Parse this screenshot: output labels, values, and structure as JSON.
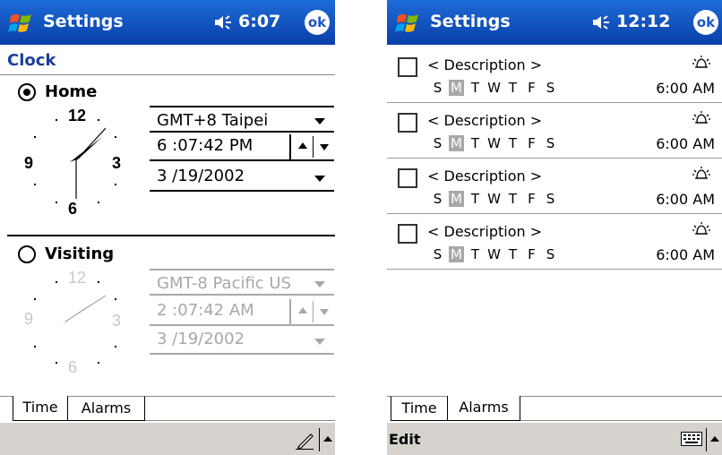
{
  "left": {
    "titlebar": {
      "title": "Settings",
      "time": "6:07",
      "ok": "ok",
      "volume_icon": "speaker-icon"
    },
    "header": "Clock",
    "home": {
      "label": "Home",
      "selected": true,
      "timezone": "GMT+8 Taipei",
      "time": "6 :07:42 PM",
      "date": "3 /19/2002",
      "clock_numbers": [
        "12",
        "3",
        "6",
        "9"
      ]
    },
    "visiting": {
      "label": "Visiting",
      "selected": false,
      "timezone": "GMT-8 Pacific US",
      "time": "2 :07:42 AM",
      "date": "3 /19/2002",
      "clock_numbers": [
        "12",
        "3",
        "6",
        "9"
      ]
    },
    "tabs": [
      "Time",
      "Alarms"
    ],
    "active_tab": "Time"
  },
  "right": {
    "titlebar": {
      "title": "Settings",
      "time": "12:12",
      "ok": "ok",
      "volume_icon": "speaker-icon"
    },
    "alarms": [
      {
        "description": "< Description >",
        "days": [
          "S",
          "M",
          "T",
          "W",
          "T",
          "F",
          "S"
        ],
        "active_day": "M",
        "time": "6:00 AM",
        "checked": false
      },
      {
        "description": "< Description >",
        "days": [
          "S",
          "M",
          "T",
          "W",
          "T",
          "F",
          "S"
        ],
        "active_day": "M",
        "time": "6:00 AM",
        "checked": false
      },
      {
        "description": "< Description >",
        "days": [
          "S",
          "M",
          "T",
          "W",
          "T",
          "F",
          "S"
        ],
        "active_day": "M",
        "time": "6:00 AM",
        "checked": false
      },
      {
        "description": "< Description >",
        "days": [
          "S",
          "M",
          "T",
          "W",
          "T",
          "F",
          "S"
        ],
        "active_day": "M",
        "time": "6:00 AM",
        "checked": false
      }
    ],
    "tabs": [
      "Time",
      "Alarms"
    ],
    "active_tab": "Alarms",
    "menu": {
      "edit": "Edit"
    }
  },
  "colors": {
    "titlebar": "#1d55c8",
    "header_text": "#1d3f9d",
    "disabled": "#a8a8a8",
    "menubar": "#d6d3ce"
  }
}
